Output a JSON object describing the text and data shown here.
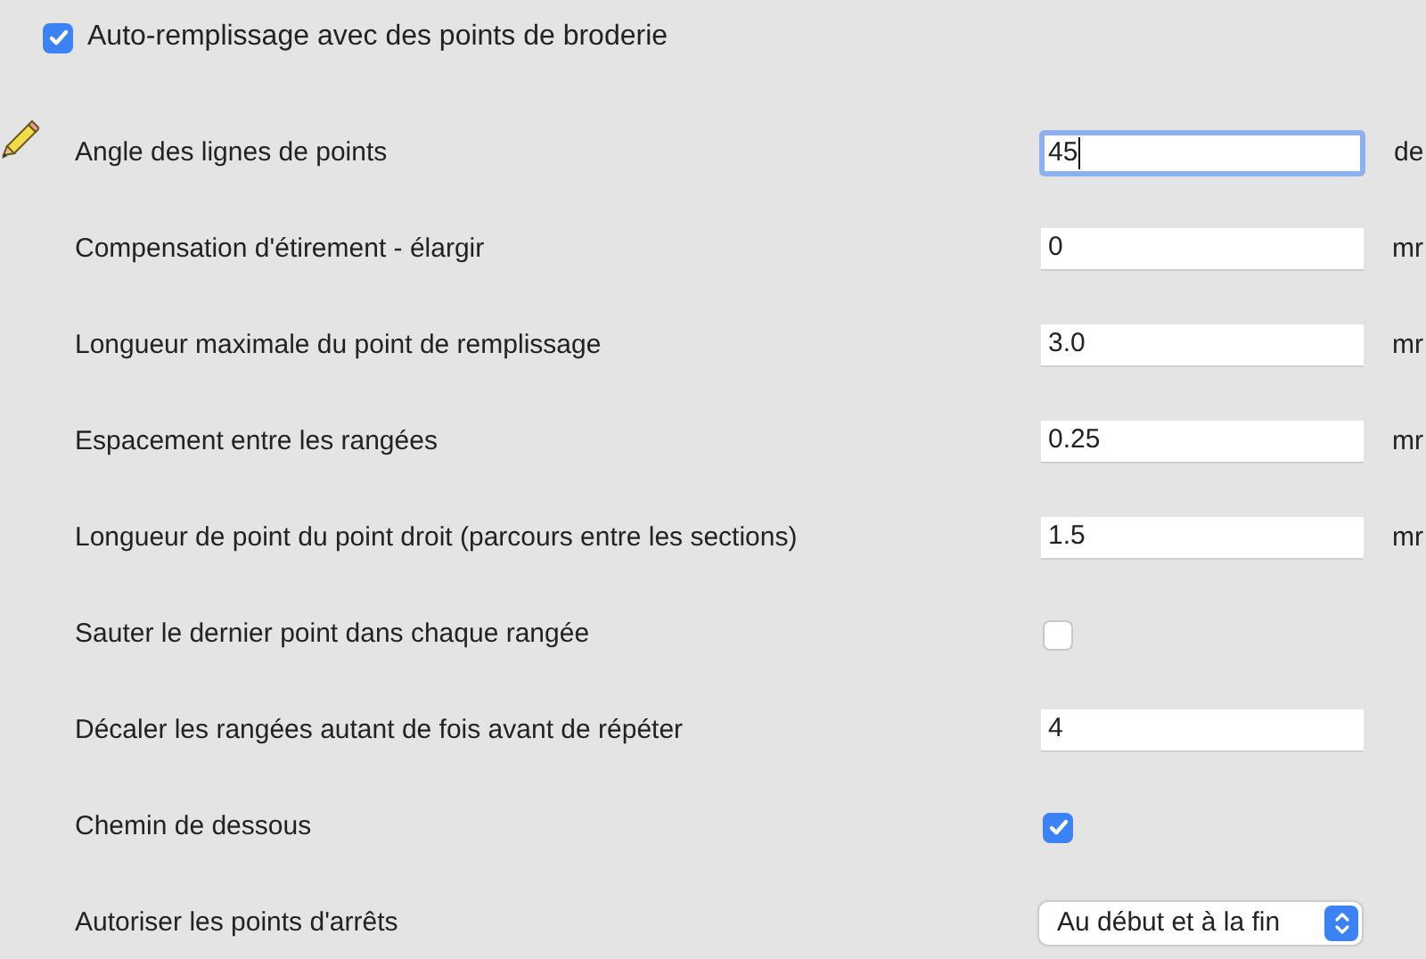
{
  "header": {
    "label": "Auto-remplissage avec des points de broderie",
    "checked": true
  },
  "rows": [
    {
      "kind": "text",
      "label": "Angle des lignes de points",
      "value": "45",
      "unit": "de",
      "focused": true,
      "edit_icon": true
    },
    {
      "kind": "text",
      "label": "Compensation d'étirement - élargir",
      "value": "0",
      "unit": "mr",
      "focused": false
    },
    {
      "kind": "text",
      "label": "Longueur maximale du point de remplissage",
      "value": "3.0",
      "unit": "mr",
      "focused": false
    },
    {
      "kind": "text",
      "label": "Espacement entre les rangées",
      "value": "0.25",
      "unit": "mr",
      "focused": false
    },
    {
      "kind": "text",
      "label": "Longueur de point du point droit (parcours entre les sections)",
      "value": "1.5",
      "unit": "mr",
      "focused": false
    },
    {
      "kind": "checkbox",
      "label": "Sauter le dernier point dans chaque rangée",
      "checked": false
    },
    {
      "kind": "text",
      "label": "Décaler les rangées autant de fois avant de répéter",
      "value": "4",
      "focused": false
    },
    {
      "kind": "checkbox",
      "label": "Chemin de dessous",
      "checked": true
    },
    {
      "kind": "select",
      "label": "Autoriser les points d'arrêts",
      "value": "Au début et à la fin"
    }
  ]
}
